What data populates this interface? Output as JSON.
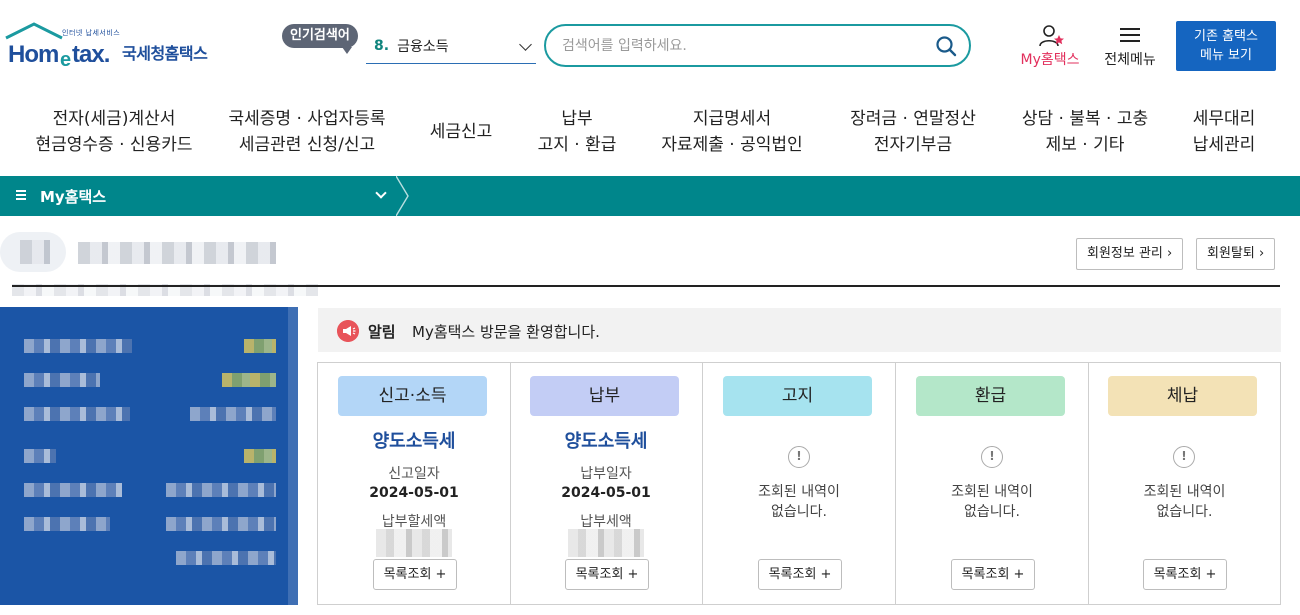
{
  "header": {
    "logo_text": "Hometax.",
    "logo_sub": "인터넷 납세서비스",
    "logo_ko": "국세청홈택스",
    "popular_label": "인기검색어",
    "popular_rank": "8.",
    "popular_term": "금융소득",
    "search_placeholder": "검색어를 입력하세요.",
    "myhometax_label": "My홈택스",
    "allmenu_label": "전체메뉴",
    "old_menu_line1": "기존 홈택스",
    "old_menu_line2": "메뉴 보기"
  },
  "gnb": [
    {
      "line1": "전자(세금)계산서",
      "line2": "현금영수증 · 신용카드"
    },
    {
      "line1": "국세증명 · 사업자등록",
      "line2": "세금관련 신청/신고"
    },
    {
      "line1": "세금신고",
      "line2": ""
    },
    {
      "line1": "납부",
      "line2": "고지 · 환급"
    },
    {
      "line1": "지급명세서",
      "line2": "자료제출 · 공익법인"
    },
    {
      "line1": "장려금 · 연말정산",
      "line2": "전자기부금"
    },
    {
      "line1": "상담 · 불복 · 고충",
      "line2": "제보 · 기타"
    },
    {
      "line1": "세무대리",
      "line2": "납세관리"
    }
  ],
  "breadcrumb": {
    "title": "My홈택스"
  },
  "user": {
    "member_info_btn": "회원정보 관리 ›",
    "withdraw_btn": "회원탈퇴 ›"
  },
  "notice": {
    "label": "알림",
    "text": "My홈택스 방문을 환영합니다."
  },
  "cards": [
    {
      "head": "신고·소득",
      "color": "#b3d6f7",
      "tax": "양도소득세",
      "date_label": "신고일자",
      "date": "2024-05-01",
      "amount_label": "납부할세액",
      "button": "목록조회 +"
    },
    {
      "head": "납부",
      "color": "#c3cdf5",
      "tax": "양도소득세",
      "date_label": "납부일자",
      "date": "2024-05-01",
      "amount_label": "납부세액",
      "button": "목록조회 +"
    },
    {
      "head": "고지",
      "color": "#a6e3ef",
      "empty_icon": "!",
      "empty_line1": "조회된 내역이",
      "empty_line2": "없습니다.",
      "button": "목록조회 +"
    },
    {
      "head": "환급",
      "color": "#b4e7c9",
      "empty_icon": "!",
      "empty_line1": "조회된 내역이",
      "empty_line2": "없습니다.",
      "button": "목록조회 +"
    },
    {
      "head": "체납",
      "color": "#f3e2b6",
      "empty_icon": "!",
      "empty_line1": "조회된 내역이",
      "empty_line2": "없습니다.",
      "button": "목록조회 +"
    }
  ],
  "colors": {
    "teal_bar": "#00868b",
    "brand_blue": "#1f4f9c",
    "accent_pink": "#e2305d",
    "button_blue": "#1565c0",
    "side_panel": "#1b55a6"
  }
}
